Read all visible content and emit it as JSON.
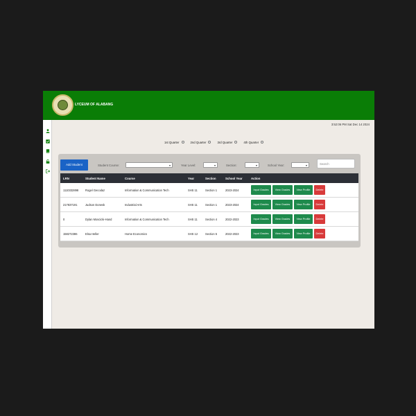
{
  "header": {
    "brand": "LYCEUM OF ALABANG"
  },
  "datetime": "3:52:06 PM Sat Dec 14 2024",
  "sidebar": {
    "icons": [
      "user-icon",
      "grades-icon",
      "book-icon",
      "lock-icon",
      "logout-icon"
    ]
  },
  "quarters": [
    {
      "label": "1st Quarter"
    },
    {
      "label": "2nd Quarter"
    },
    {
      "label": "3rd Quarter"
    },
    {
      "label": "4th Quarter"
    }
  ],
  "filters": {
    "add_student": "Add Student",
    "student_course": "Student Course:",
    "year_level": "Year Level:",
    "section": "Section:",
    "school_year": "School Year:",
    "search_placeholder": "Search"
  },
  "table": {
    "columns": [
      "LRN",
      "Student Name",
      "Course",
      "Year",
      "Section",
      "School Year",
      "Action"
    ],
    "actions": {
      "input_grades": "Input Grades",
      "view_grades": "View Grades",
      "view_profile": "View Profile",
      "delete": "Delete"
    },
    "rows": [
      {
        "lrn": "1110332898",
        "name": "Rogel Gecodaz",
        "course": "Information & Communication Tech",
        "year": "SHS 11",
        "section": "Section 1",
        "school_year": "2023-2024"
      },
      {
        "lrn": "217837191",
        "name": "Judson Donesk",
        "course": "Industrial Arts",
        "year": "SHS 11",
        "section": "Section 1",
        "school_year": "2023-2024"
      },
      {
        "lrn": "0",
        "name": "Dylan Moscicki-Hand",
        "course": "Information & Communication Tech",
        "year": "SHS 11",
        "section": "Section 4",
        "school_year": "2022-2023"
      },
      {
        "lrn": "158272386",
        "name": "Elsa Heller",
        "course": "Home Economics",
        "year": "SHS 12",
        "section": "Section 5",
        "school_year": "2022-2023"
      }
    ]
  },
  "colors": {
    "header": "#0a7d06",
    "primary": "#1a63c6",
    "success": "#1e8a4c",
    "danger": "#d83a3a",
    "table_head": "#2c2f36"
  }
}
